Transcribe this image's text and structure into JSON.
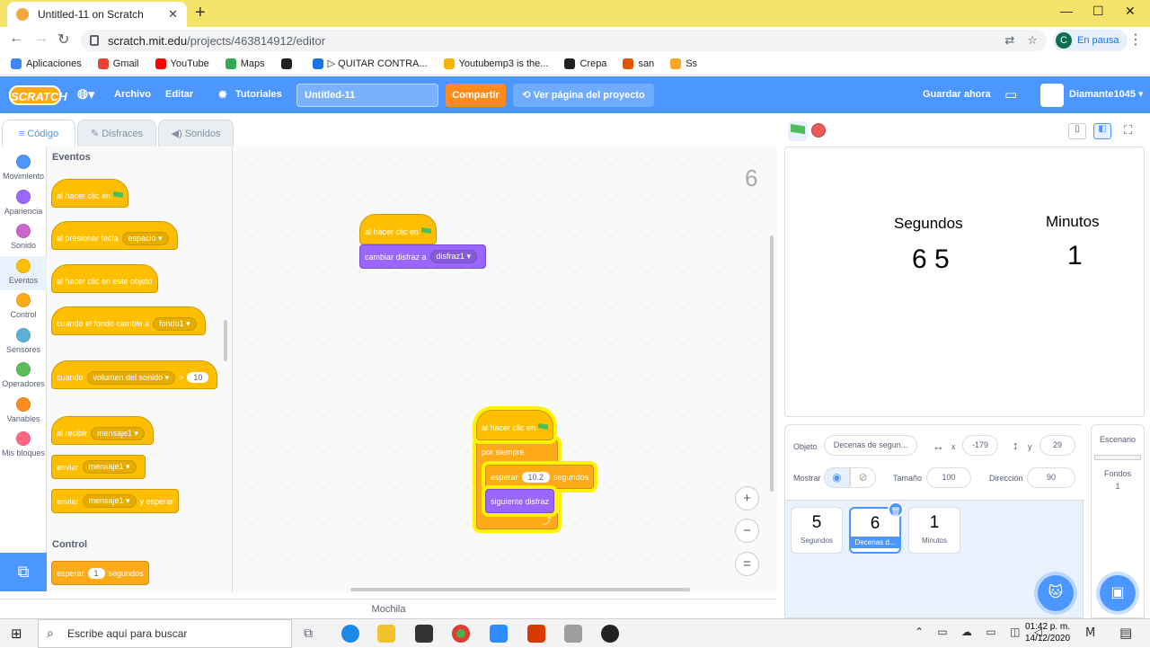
{
  "browser": {
    "tab_title": "Untitled-11 on Scratch",
    "url_host": "scratch.mit.edu",
    "url_path": "/projects/463814912/editor",
    "profile_initial": "C",
    "profile_status": "En pausa",
    "bookmarks": [
      {
        "label": "Aplicaciones",
        "color": "#4285f4"
      },
      {
        "label": "Gmail",
        "color": "#ea4335"
      },
      {
        "label": "YouTube",
        "color": "#ff0000"
      },
      {
        "label": "Maps",
        "color": "#34a853"
      },
      {
        "label": "",
        "color": "#202124"
      },
      {
        "label": "▷ QUITAR CONTRA...",
        "color": "#1a73e8"
      },
      {
        "label": "Youtubemp3 is the...",
        "color": "#f4b400"
      },
      {
        "label": "Crepa",
        "color": "#202124"
      },
      {
        "label": "san",
        "color": "#e65100"
      },
      {
        "label": "Ss",
        "color": "#f9a825"
      }
    ]
  },
  "menu": {
    "logo": "SCRATCH",
    "file": "Archivo",
    "edit": "Editar",
    "tutorials": "Tutoriales",
    "project_title": "Untitled-11",
    "share": "Compartir",
    "see_project": "Ver página del proyecto",
    "save_now": "Guardar ahora",
    "username": "Diamante1045"
  },
  "editor_tabs": [
    "Código",
    "Disfraces",
    "Sonidos"
  ],
  "categories": [
    {
      "label": "Movimiento",
      "color": "#4c97ff"
    },
    {
      "label": "Apariencia",
      "color": "#9966ff"
    },
    {
      "label": "Sonido",
      "color": "#cf63cf"
    },
    {
      "label": "Eventos",
      "color": "#ffbf00"
    },
    {
      "label": "Control",
      "color": "#ffab19"
    },
    {
      "label": "Sensores",
      "color": "#5cb1d6"
    },
    {
      "label": "Operadores",
      "color": "#59c059"
    },
    {
      "label": "Variables",
      "color": "#ff8c1a"
    },
    {
      "label": "Mis bloques",
      "color": "#ff6680"
    }
  ],
  "palette": {
    "events_heading": "Eventos",
    "control_heading": "Control",
    "when_flag": "al hacer clic en",
    "when_key": "al presionar tecla",
    "key_value": "espacio",
    "when_sprite_clicked": "al hacer clic en este objeto",
    "when_backdrop": "cuando el fondo cambie a",
    "backdrop_value": "fondo1",
    "when_prefix": "cuando",
    "loudness": "volumen del sonido",
    "gt": ">",
    "loud_value": "10",
    "when_receive": "al recibir",
    "message": "mensaje1",
    "broadcast": "enviar",
    "and_wait": "y esperar",
    "wait": "esperar",
    "wait_value": "1",
    "seconds": "segundos"
  },
  "workspace": {
    "sprite_costume_number": "6",
    "script1": {
      "hat": "al hacer clic en",
      "switch_costume": "cambiar disfraz a",
      "costume": "disfraz1"
    },
    "script2": {
      "hat": "al hacer clic en",
      "forever": "por siempre",
      "wait": "esperar",
      "wait_value": "10.2",
      "seconds": "segundos",
      "next_costume": "siguiente disfraz"
    },
    "backpack": "Mochila"
  },
  "stage": {
    "seconds_label": "Segundos",
    "seconds_value": "6 5",
    "minutes_label": "Minutos",
    "minutes_value": "1"
  },
  "sprite_info": {
    "object_label": "Objeto",
    "object_name": "Decenas de segun...",
    "x_label": "x",
    "x_value": "-179",
    "y_label": "y",
    "y_value": "29",
    "show_label": "Mostrar",
    "size_label": "Tamaño",
    "size_value": "100",
    "direction_label": "Dirección",
    "direction_value": "90"
  },
  "sprites": [
    {
      "glyph": "5",
      "name": "Segundos"
    },
    {
      "glyph": "6",
      "name": "Decenas d..."
    },
    {
      "glyph": "1",
      "name": "Minutos"
    }
  ],
  "stage_panel": {
    "title": "Escenario",
    "backdrops_label": "Fondos",
    "backdrops_count": "1"
  },
  "taskbar": {
    "search_placeholder": "Escribe aquí para buscar",
    "time": "01:42 p. m.",
    "date": "14/12/2020"
  }
}
